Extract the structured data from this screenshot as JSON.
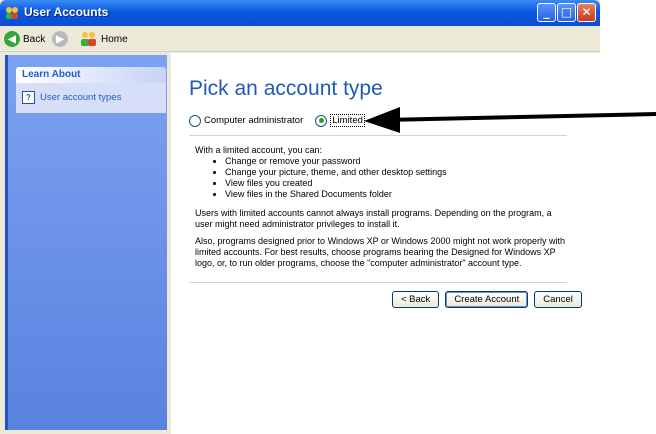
{
  "window": {
    "title": "User Accounts"
  },
  "titlebar_buttons": {
    "minimize": "_",
    "maximize": "□",
    "close": "✕"
  },
  "toolbar": {
    "back_label": "Back",
    "home_label": "Home"
  },
  "sidebar": {
    "section_title": "Learn About",
    "items": [
      {
        "label": "User account types",
        "icon": "help-icon"
      }
    ]
  },
  "main": {
    "heading": "Pick an account type",
    "options": {
      "admin_label": "Computer administrator",
      "limited_label": "Limited",
      "selected": "Limited"
    },
    "intro": "With a limited account, you can:",
    "bullets": [
      "Change or remove your password",
      "Change your picture, theme, and other desktop settings",
      "View files you created",
      "View files in the Shared Documents folder"
    ],
    "para1": "Users with limited accounts cannot always install programs. Depending on the program, a user might need administrator privileges to install it.",
    "para2": "Also, programs designed prior to Windows XP or Windows 2000 might not work properly with limited accounts. For best results, choose programs bearing the Designed for Windows XP logo, or, to run older programs, choose the \"computer administrator\" account type.",
    "buttons": {
      "back": "< Back",
      "create": "Create Account",
      "cancel": "Cancel"
    }
  },
  "colors": {
    "titlebar": "#0a57e0",
    "heading": "#1f5bb5",
    "sidebar": "#6d93e8",
    "radio_checked": "#21a121"
  }
}
